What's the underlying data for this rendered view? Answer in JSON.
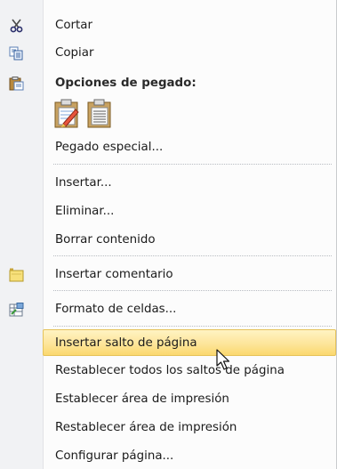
{
  "menu": {
    "cut": "Cortar",
    "copy": "Copiar",
    "paste_options_header": "Opciones de pegado:",
    "paste_special": "Pegado especial...",
    "insert": "Insertar...",
    "delete": "Eliminar...",
    "clear_contents": "Borrar contenido",
    "insert_comment": "Insertar comentario",
    "format_cells": "Formato de celdas...",
    "insert_page_break": "Insertar salto de página",
    "reset_all_page_breaks": "Restablecer todos los saltos de página",
    "set_print_area": "Establecer área de impresión",
    "reset_print_area": "Restablecer área de impresión",
    "page_setup": "Configurar página..."
  },
  "icons": {
    "cut": "scissors-icon",
    "copy": "copy-icon",
    "paste": "clipboard-icon",
    "paste_formatting": "paste-formatting-icon",
    "paste_values": "paste-values-icon",
    "comment": "comment-icon",
    "format_cells": "format-cells-icon"
  },
  "state": {
    "highlighted_item": "Insertar salto de página"
  },
  "colors": {
    "highlight": "#fde59a",
    "highlight_border": "#e6c35a"
  }
}
